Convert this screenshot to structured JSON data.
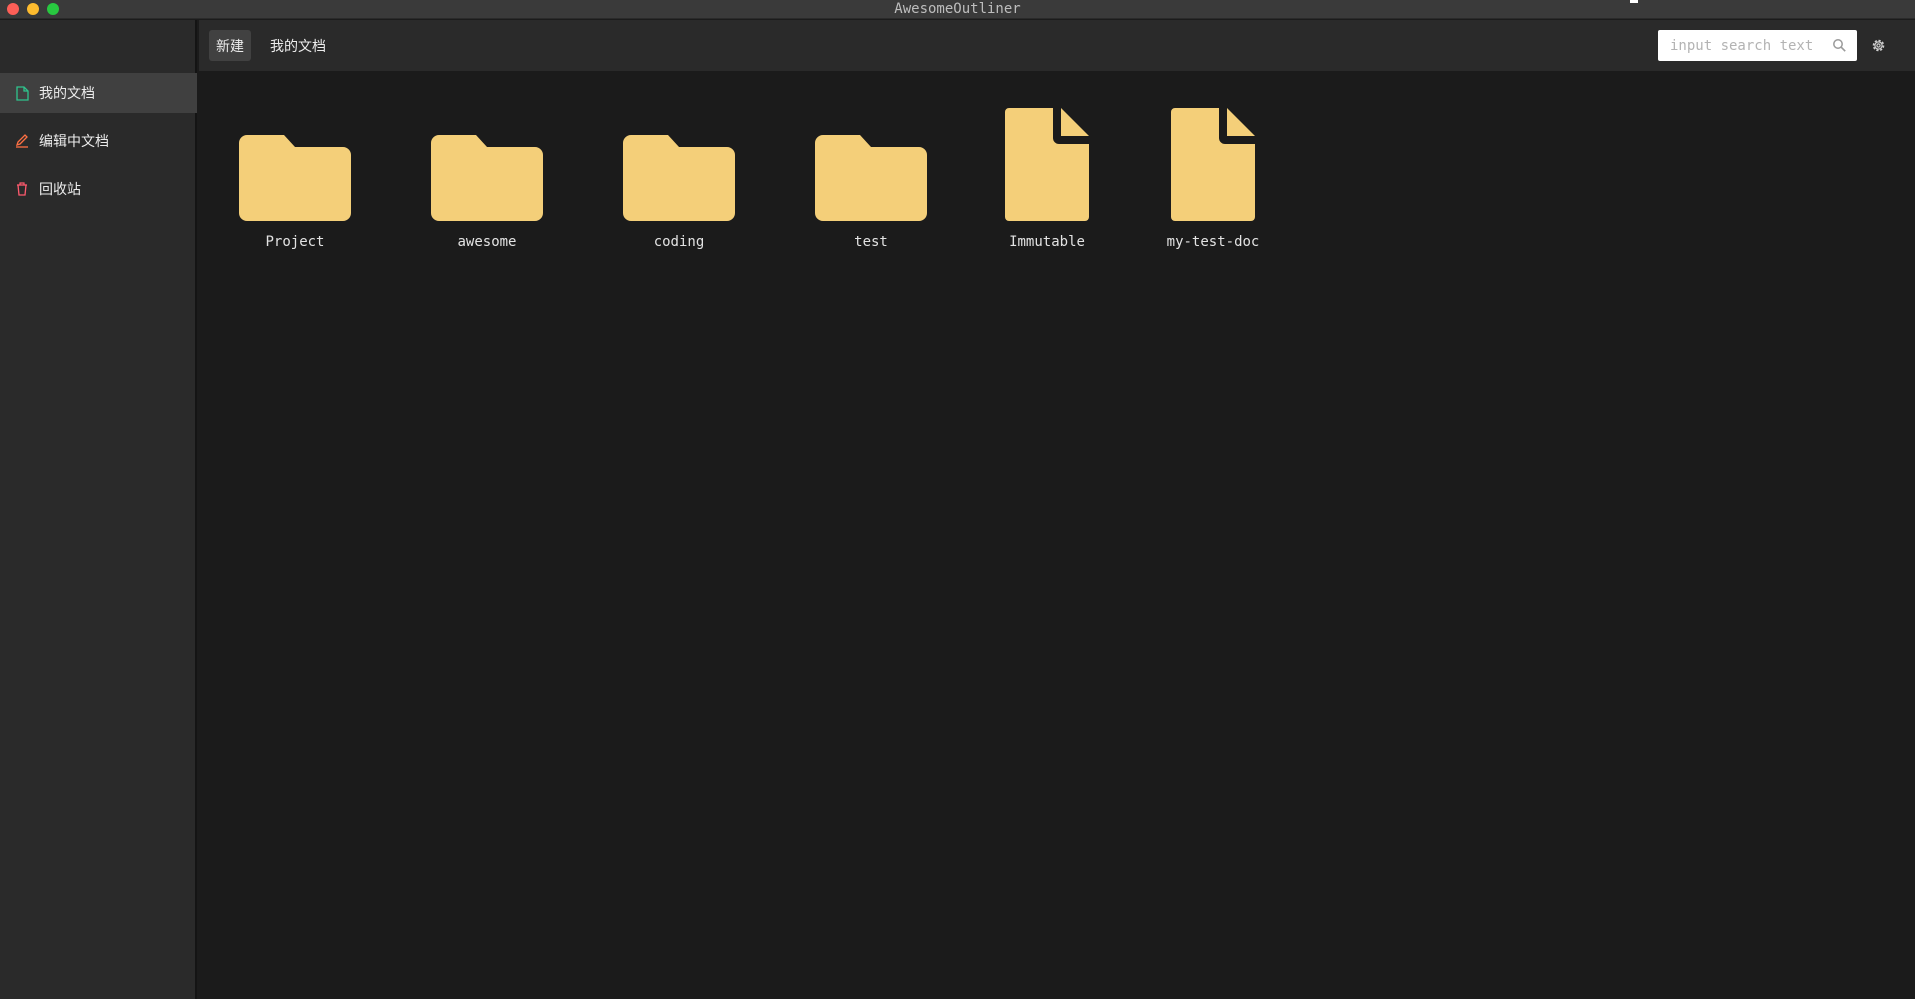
{
  "window": {
    "title": "AwesomeOutliner"
  },
  "sidebar": {
    "items": [
      {
        "label": "我的文档",
        "icon": "document-icon",
        "active": true,
        "color": "#2fc48d"
      },
      {
        "label": "编辑中文档",
        "icon": "edit-icon",
        "active": false,
        "color": "#ff7043"
      },
      {
        "label": "回收站",
        "icon": "trash-icon",
        "active": false,
        "color": "#ff5a6e"
      }
    ]
  },
  "toolbar": {
    "new_label": "新建",
    "breadcrumb_label": "我的文档",
    "search_placeholder": "input search text"
  },
  "files": [
    {
      "name": "Project",
      "type": "folder"
    },
    {
      "name": "awesome",
      "type": "folder"
    },
    {
      "name": "coding",
      "type": "folder"
    },
    {
      "name": "test",
      "type": "folder"
    },
    {
      "name": "Immutable",
      "type": "document"
    },
    {
      "name": "my-test-doc",
      "type": "document"
    }
  ],
  "colors": {
    "folder": "#f4cf79",
    "accent_active": "#404040"
  }
}
